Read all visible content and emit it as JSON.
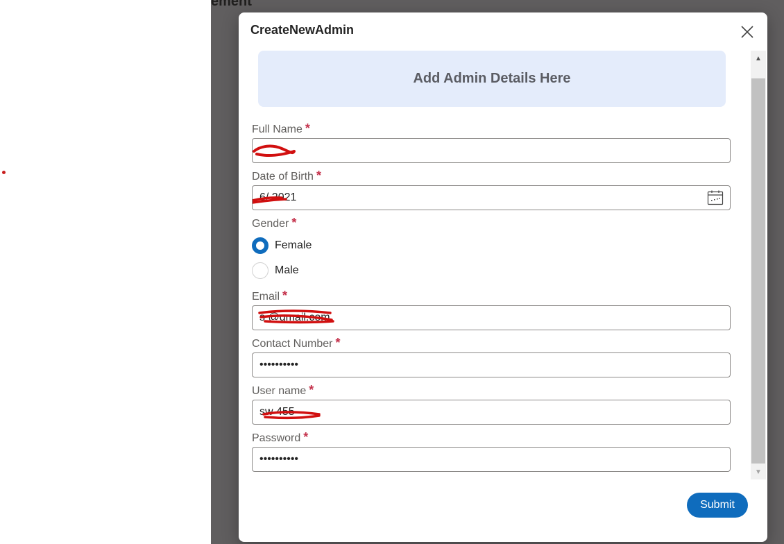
{
  "background_page": {
    "heading_fragment": "ement"
  },
  "dialog": {
    "title": "CreateNewAdmin",
    "banner_text": "Add Admin Details Here",
    "close_icon": "close-icon",
    "required_marker": "*"
  },
  "form": {
    "full_name": {
      "label": "Full Name",
      "value": ""
    },
    "date_of_birth": {
      "label": "Date of Birth",
      "value": "6/ 2021",
      "icon": "calendar-icon"
    },
    "gender": {
      "label": "Gender",
      "options": [
        {
          "label": "Female",
          "checked": true
        },
        {
          "label": "Male",
          "checked": false
        }
      ]
    },
    "email": {
      "label": "Email",
      "value": "s @gmail.com"
    },
    "contact_number": {
      "label": "Contact Number",
      "value": "••••••••••"
    },
    "user_name": {
      "label": "User name",
      "value": "sw 455"
    },
    "password": {
      "label": "Password",
      "value": "••••••••••"
    }
  },
  "actions": {
    "submit_label": "Submit"
  },
  "colors": {
    "accent": "#0f6cbd",
    "required": "#c4314b",
    "banner_bg": "#e4ecfb",
    "overlay": "#605e5f",
    "redaction": "#d10f0f"
  }
}
